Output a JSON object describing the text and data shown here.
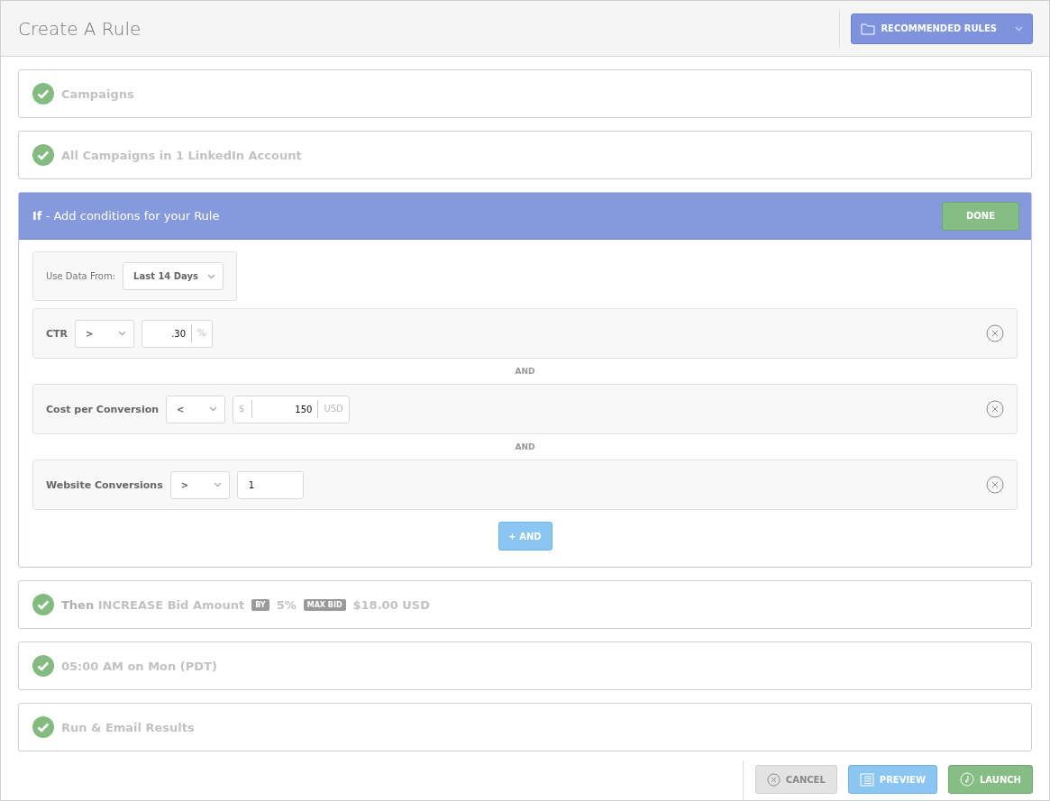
{
  "header": {
    "title": "Create A Rule",
    "recommended_button": "RECOMMENDED RULES"
  },
  "steps_before": [
    {
      "kind": "summary",
      "done": true,
      "parts": [
        {
          "kind": "text",
          "text": "Campaigns"
        }
      ]
    },
    {
      "kind": "summary",
      "done": true,
      "parts": [
        {
          "kind": "text",
          "text": "All Campaigns in 1 LinkedIn Account"
        }
      ]
    }
  ],
  "conditions_panel": {
    "title": "**If** - Add conditions for your Rule",
    "done_button": "DONE",
    "data_range": {
      "label": "Use Data From:",
      "value": "Last 14 Days"
    },
    "conditions": [
      {
        "metric": "CTR",
        "operator": ">",
        "value": ".30",
        "suffix": "%"
      },
      {
        "joiner": "AND",
        "metric": "Cost per Conversion",
        "operator": "<",
        "prefix": "$",
        "value": "150",
        "suffix": "USD"
      },
      {
        "joiner": "AND",
        "metric": "Website Conversions",
        "operator": ">",
        "value": "1"
      }
    ],
    "add_button": "+ AND"
  },
  "steps_after": [
    {
      "kind": "summary",
      "done": true,
      "parts": [
        {
          "kind": "text",
          "text": "**Then** INCREASE Bid Amount"
        },
        {
          "kind": "badge",
          "text": "BY"
        },
        {
          "kind": "text",
          "text": "5%"
        },
        {
          "kind": "badge",
          "text": "MAX BID"
        },
        {
          "kind": "text",
          "text": "$18.00 USD"
        }
      ]
    },
    {
      "kind": "summary",
      "done": true,
      "parts": [
        {
          "kind": "text",
          "text": "05:00 AM on Mon (PDT)"
        }
      ]
    },
    {
      "kind": "summary",
      "done": true,
      "parts": [
        {
          "kind": "text",
          "text": "Run & Email Results"
        }
      ]
    }
  ],
  "footer": {
    "buttons": [
      {
        "kind": "cancel",
        "label": "CANCEL"
      },
      {
        "kind": "preview",
        "label": "PREVIEW"
      },
      {
        "kind": "launch",
        "label": "LAUNCH"
      }
    ]
  }
}
